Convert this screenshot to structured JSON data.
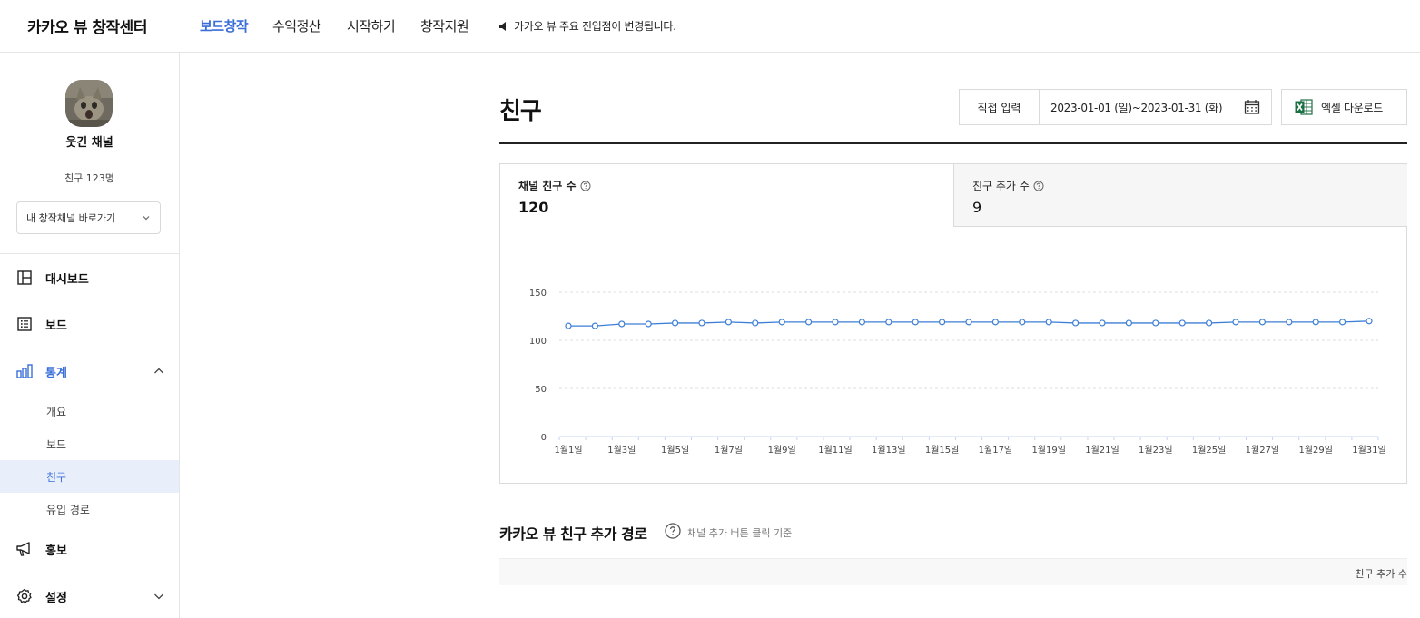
{
  "header": {
    "brand": "카카오 뷰 창작센터",
    "nav": [
      "보드창작",
      "수익정산",
      "시작하기",
      "창작지원"
    ],
    "notice": "카카오 뷰 주요 진입점이 변경됩니다."
  },
  "sidebar": {
    "channel_name": "웃긴 채널",
    "friend_count": "친구 123명",
    "channel_select": "내 창작채널 바로가기",
    "menu": {
      "dashboard": "대시보드",
      "board": "보드",
      "stats": "통계",
      "promo": "홍보",
      "settings": "설정"
    },
    "stats_sub": [
      "개요",
      "보드",
      "친구",
      "유입 경로"
    ]
  },
  "main": {
    "title": "친구",
    "direct_input": "직접 입력",
    "date_range": "2023-01-01 (일)~2023-01-31 (화)",
    "excel_label": "엑셀 다운로드",
    "tabs": [
      {
        "label": "채널 친구 수",
        "value": "120"
      },
      {
        "label": "친구 추가 수",
        "value": "9"
      }
    ],
    "section_title": "카카오 뷰 친구 추가 경로",
    "section_sub": "채널 추가 버튼 클릭 기준",
    "table_header": "친구 추가 수"
  },
  "colors": {
    "accent": "#3b6fd8",
    "line": "#3d7fd6",
    "excel_green": "#1d7044"
  },
  "chart_data": {
    "type": "line",
    "x": [
      "1월1일",
      "1월2일",
      "1월3일",
      "1월4일",
      "1월5일",
      "1월6일",
      "1월7일",
      "1월8일",
      "1월9일",
      "1월10일",
      "1월11일",
      "1월12일",
      "1월13일",
      "1월14일",
      "1월15일",
      "1월16일",
      "1월17일",
      "1월18일",
      "1월19일",
      "1월20일",
      "1월21일",
      "1월22일",
      "1월23일",
      "1월24일",
      "1월25일",
      "1월26일",
      "1월27일",
      "1월28일",
      "1월29일",
      "1월30일",
      "1월31일"
    ],
    "x_tick_labels": [
      "1월1일",
      "1월3일",
      "1월5일",
      "1월7일",
      "1월9일",
      "1월11일",
      "1월13일",
      "1월15일",
      "1월17일",
      "1월19일",
      "1월21일",
      "1월23일",
      "1월25일",
      "1월27일",
      "1월29일",
      "1월31일"
    ],
    "series": [
      {
        "values": [
          115,
          115,
          117,
          117,
          118,
          118,
          119,
          118,
          119,
          119,
          119,
          119,
          119,
          119,
          119,
          119,
          119,
          119,
          119,
          118,
          118,
          118,
          118,
          118,
          118,
          119,
          119,
          119,
          119,
          119,
          120
        ]
      }
    ],
    "ylim": [
      0,
      150
    ],
    "yticks": [
      0,
      50,
      100,
      150
    ],
    "grid": true
  }
}
